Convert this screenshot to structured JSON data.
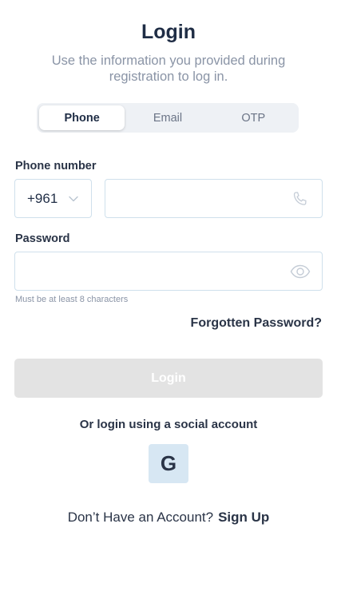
{
  "header": {
    "title": "Login",
    "subtitle": "Use the information you provided during registration to log in."
  },
  "tabs": [
    {
      "label": "Phone",
      "active": true
    },
    {
      "label": "Email",
      "active": false
    },
    {
      "label": "OTP",
      "active": false
    }
  ],
  "phone": {
    "label": "Phone number",
    "country_code": "+961",
    "value": "",
    "placeholder": ""
  },
  "password": {
    "label": "Password",
    "value": "",
    "placeholder": "",
    "hint": "Must be at least 8 characters"
  },
  "forgot_label": "Forgotten Password?",
  "login_label": "Login",
  "social": {
    "label": "Or login using a social account",
    "google_letter": "G"
  },
  "signup": {
    "prompt": "Don’t Have an Account?",
    "link": "Sign Up"
  },
  "colors": {
    "text_primary": "#1f2d45",
    "text_muted": "#8a94a6",
    "border": "#cfe0ec",
    "button_disabled": "#e3e3e3",
    "google_bg": "#d7e7f3"
  }
}
